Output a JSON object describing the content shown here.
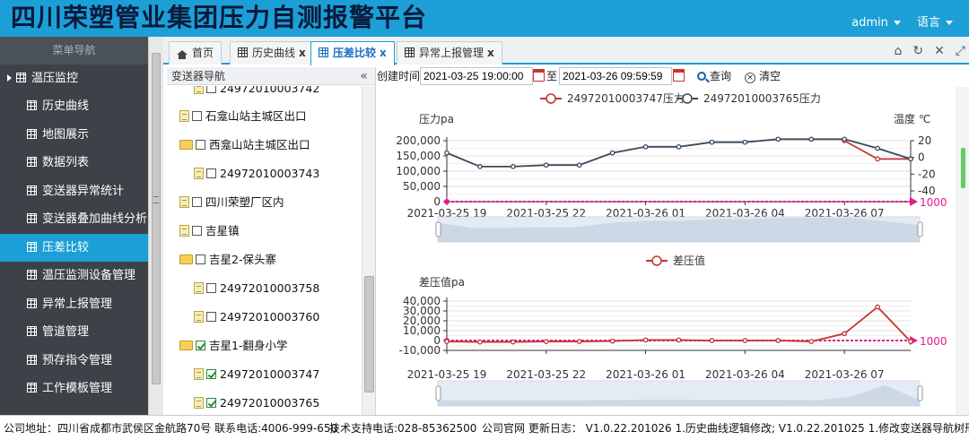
{
  "app": {
    "title": "四川荣塑管业集团压力自测报警平台",
    "user": "admin",
    "language": "语言"
  },
  "sidebar": {
    "title": "菜单导航",
    "group": "温压监控",
    "items": [
      {
        "label": "历史曲线",
        "active": false
      },
      {
        "label": "地图展示",
        "active": false
      },
      {
        "label": "数据列表",
        "active": false
      },
      {
        "label": "变送器异常统计",
        "active": false
      },
      {
        "label": "变送器叠加曲线分析",
        "active": false
      },
      {
        "label": "压差比较",
        "active": true
      },
      {
        "label": "温压监测设备管理",
        "active": false
      },
      {
        "label": "异常上报管理",
        "active": false
      },
      {
        "label": "管道管理",
        "active": false
      },
      {
        "label": "预存指令管理",
        "active": false
      },
      {
        "label": "工作模板管理",
        "active": false
      }
    ]
  },
  "tabs": [
    {
      "label": "首页",
      "closable": false
    },
    {
      "label": "历史曲线",
      "closable": true
    },
    {
      "label": "压差比较",
      "closable": true,
      "active": true
    },
    {
      "label": "异常上报管理",
      "closable": true
    }
  ],
  "tab_close_glyph": "x",
  "tree": {
    "title": "变送器导航",
    "nodes": [
      {
        "label": "24972010003742",
        "type": "leaf",
        "checked": false
      },
      {
        "label": "石龛山站主城区出口",
        "type": "leaf-group",
        "checked": false
      },
      {
        "label": "西龛山站主城区出口",
        "type": "folder",
        "checked": false
      },
      {
        "label": "24972010003743",
        "type": "leaf",
        "checked": false
      },
      {
        "label": "四川荣塑厂区内",
        "type": "leaf-group",
        "checked": false
      },
      {
        "label": "吉星镇",
        "type": "leaf-group",
        "checked": false
      },
      {
        "label": "吉星2-保头寨",
        "type": "folder",
        "checked": false
      },
      {
        "label": "24972010003758",
        "type": "leaf",
        "checked": false
      },
      {
        "label": "24972010003760",
        "type": "leaf",
        "checked": false
      },
      {
        "label": "吉星1-翻身小学",
        "type": "folder",
        "checked": true
      },
      {
        "label": "24972010003747",
        "type": "leaf",
        "checked": true
      },
      {
        "label": "24972010003765",
        "type": "leaf",
        "checked": true
      }
    ]
  },
  "query": {
    "created_label": "创建时间:",
    "start": "2021-03-25 19:00:00",
    "to_label": "至",
    "end": "2021-03-26 09:59:59",
    "search_label": "查询",
    "clear_label": "清空"
  },
  "footer": {
    "address": "公司地址：四川省成都市武侯区金航路70号 联系电话:4006-999-650",
    "support": "技术支持电话:028-85362500",
    "changelog": "公司官网 更新日志： V1.0.22.201026 1.历史曲线逻辑修改; V1.0.22.201025 1.修改变送器导航树形展示;2."
  },
  "chart_data": [
    {
      "type": "line",
      "legend_position": "top",
      "ylabel": "压力pa",
      "y2label": "温度 ℃",
      "ylim": [
        0,
        200000
      ],
      "yticks": [
        "0",
        "50,000",
        "100,000",
        "150,000",
        "200,000"
      ],
      "y2lim": [
        -40,
        20
      ],
      "y2ticks": [
        "-40",
        "-20",
        "0",
        "20"
      ],
      "xlim": [
        0,
        14
      ],
      "xticks": [
        {
          "pos": 0,
          "label": "2021-03-25 19"
        },
        {
          "pos": 3,
          "label": "2021-03-25 22"
        },
        {
          "pos": 6,
          "label": "2021-03-26 01"
        },
        {
          "pos": 9,
          "label": "2021-03-26 04"
        },
        {
          "pos": 12,
          "label": "2021-03-26 07"
        }
      ],
      "markline": {
        "value": 0,
        "label": "1000",
        "color": "#e6198f"
      },
      "series": [
        {
          "name": "24972010003747压力",
          "color": "#c23531",
          "values": [
            null,
            null,
            null,
            null,
            null,
            null,
            null,
            null,
            null,
            null,
            null,
            null,
            200000,
            140000,
            140000
          ]
        },
        {
          "name": "24972010003765压力",
          "color": "#3b4a5a",
          "values": [
            160000,
            115000,
            115000,
            120000,
            120000,
            160000,
            180000,
            180000,
            195000,
            195000,
            205000,
            205000,
            205000,
            175000,
            140000
          ]
        }
      ]
    },
    {
      "type": "line",
      "legend_position": "top",
      "ylabel": "差压值pa",
      "ylim": [
        -10000,
        40000
      ],
      "yticks": [
        "-10,000",
        "0",
        "10,000",
        "20,000",
        "30,000",
        "40,000"
      ],
      "xlim": [
        0,
        14
      ],
      "xticks": [
        {
          "pos": 0,
          "label": "2021-03-25 19"
        },
        {
          "pos": 3,
          "label": "2021-03-25 22"
        },
        {
          "pos": 6,
          "label": "2021-03-26 01"
        },
        {
          "pos": 9,
          "label": "2021-03-26 04"
        },
        {
          "pos": 12,
          "label": "2021-03-26 07"
        }
      ],
      "markline": {
        "value": 0,
        "label": "1000",
        "color": "#e6198f"
      },
      "series": [
        {
          "name": "差压值",
          "color": "#c23531",
          "values": [
            -1000,
            -1500,
            -1500,
            -1000,
            -1000,
            -500,
            500,
            500,
            0,
            0,
            0,
            -1000,
            7000,
            34000,
            -1000
          ]
        }
      ]
    }
  ]
}
